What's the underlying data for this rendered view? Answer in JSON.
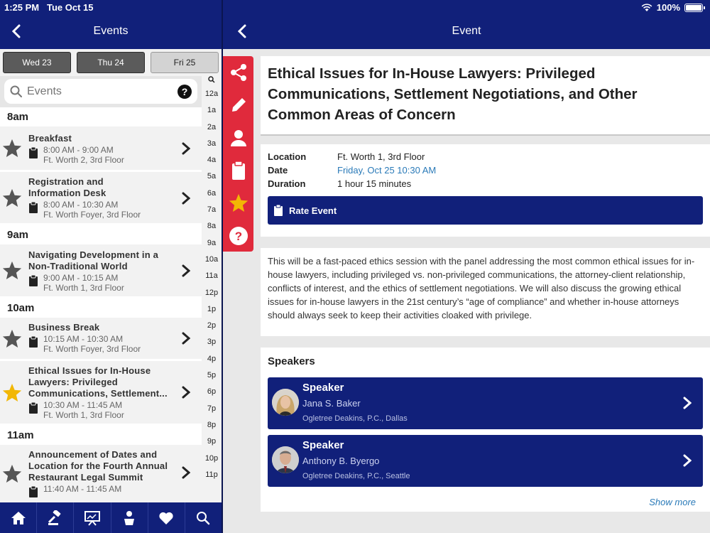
{
  "status": {
    "time": "1:25 PM",
    "date": "Tue Oct 15",
    "battery": "100%"
  },
  "left_nav": {
    "title": "Events"
  },
  "right_nav": {
    "title": "Event"
  },
  "day_tabs": [
    {
      "label": "Wed 23",
      "active": false
    },
    {
      "label": "Thu 24",
      "active": false
    },
    {
      "label": "Fri 25",
      "active": true
    }
  ],
  "search": {
    "placeholder": "Events"
  },
  "index_letters": [
    "12a",
    "1a",
    "2a",
    "3a",
    "4a",
    "5a",
    "6a",
    "7a",
    "8a",
    "9a",
    "10a",
    "11a",
    "12p",
    "1p",
    "2p",
    "3p",
    "4p",
    "5p",
    "6p",
    "7p",
    "8p",
    "9p",
    "10p",
    "11p"
  ],
  "schedule": {
    "h8": "8am",
    "h9": "9am",
    "h10": "10am",
    "h11": "11am",
    "events": [
      {
        "title": "Breakfast",
        "time": "8:00 AM - 9:00 AM",
        "location": "Ft. Worth 2, 3rd Floor",
        "starred": false
      },
      {
        "title": "Registration and Information Desk",
        "time": "8:00 AM - 10:30 AM",
        "location": "Ft. Worth Foyer, 3rd Floor",
        "starred": false
      },
      {
        "title": "Navigating Development in a Non-Traditional World",
        "time": "9:00 AM - 10:15 AM",
        "location": "Ft. Worth 1, 3rd Floor",
        "starred": false
      },
      {
        "title": "Business Break",
        "time": "10:15 AM - 10:30 AM",
        "location": "Ft. Worth Foyer, 3rd Floor",
        "starred": false
      },
      {
        "title": "Ethical Issues for In-House Lawyers: Privileged Communications, Settlement...",
        "time": "10:30 AM - 11:45 AM",
        "location": "Ft. Worth 1, 3rd Floor",
        "starred": true
      },
      {
        "title": "Announcement of Dates and Location for the Fourth Annual Restaurant Legal Summit",
        "time": "11:40 AM - 11:45 AM",
        "location": "",
        "starred": false
      }
    ]
  },
  "event": {
    "title": "Ethical Issues for In-House Lawyers: Privileged Communications, Settlement Negotiations, and Other Common Areas of Concern",
    "location_label": "Location",
    "location": "Ft. Worth 1, 3rd Floor",
    "date_label": "Date",
    "date": "Friday, Oct 25 10:30 AM",
    "duration_label": "Duration",
    "duration": "1 hour 15 minutes",
    "rate_label": "Rate Event",
    "description": "This will be a fast-paced ethics session with the panel addressing the most common ethical issues for in-house lawyers, including privileged vs. non-privileged communications, the attorney-client relationship, conflicts of interest, and the ethics of settlement negotiations.  We will also discuss the growing ethical issues for in-house lawyers in the 21st century’s “age of compliance” and whether in-house attorneys should always seek to keep their activities cloaked with privilege."
  },
  "speakers": {
    "heading": "Speakers",
    "items": [
      {
        "role": "Speaker",
        "name": "Jana S. Baker",
        "firm": "Ogletree Deakins, P.C., Dallas"
      },
      {
        "role": "Speaker",
        "name": "Anthony B. Byergo",
        "firm": "Ogletree Deakins, P.C., Seattle"
      }
    ],
    "show_more": "Show more"
  },
  "colors": {
    "navy": "#11207a",
    "red": "#e02a3c",
    "star_gold": "#f2b705",
    "link": "#2a7ab8"
  }
}
